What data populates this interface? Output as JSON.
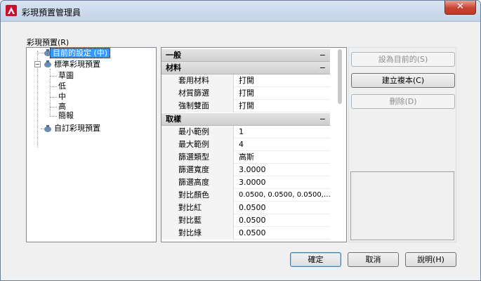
{
  "window": {
    "title": "彩現預置管理員",
    "close_glyph": "✕"
  },
  "tree": {
    "group_label": "彩現預置(R)",
    "items": [
      {
        "label": "目前的設定 (中)",
        "selected": true
      },
      {
        "label": "標準彩現預置"
      },
      {
        "label": "草圖"
      },
      {
        "label": "低"
      },
      {
        "label": "中"
      },
      {
        "label": "高"
      },
      {
        "label": "簡報"
      },
      {
        "label": "自訂彩現預置"
      }
    ]
  },
  "properties": {
    "collapse_glyph": "−",
    "sections": [
      {
        "title": "一般",
        "rows": []
      },
      {
        "title": "材料",
        "rows": [
          {
            "name": "套用材料",
            "value": "打開"
          },
          {
            "name": "材質篩選",
            "value": "打開"
          },
          {
            "name": "強制雙面",
            "value": "打開"
          }
        ]
      },
      {
        "title": "取樣",
        "rows": [
          {
            "name": "最小範例",
            "value": "1"
          },
          {
            "name": "最大範例",
            "value": "4"
          },
          {
            "name": "篩選類型",
            "value": "高斯"
          },
          {
            "name": "篩選寬度",
            "value": "3.0000"
          },
          {
            "name": "篩選高度",
            "value": "3.0000"
          },
          {
            "name": "對比顏色",
            "value": "0.0500, 0.0500, 0.0500,…"
          },
          {
            "name": "對比紅",
            "value": "0.0500"
          },
          {
            "name": "對比藍",
            "value": "0.0500"
          },
          {
            "name": "對比綠",
            "value": "0.0500"
          }
        ]
      }
    ]
  },
  "actions": {
    "set_current": "設為目前的(S)",
    "create_copy": "建立複本(C)",
    "delete": "刪除(D)"
  },
  "footer": {
    "ok": "確定",
    "cancel": "取消",
    "help": "說明(H)"
  }
}
